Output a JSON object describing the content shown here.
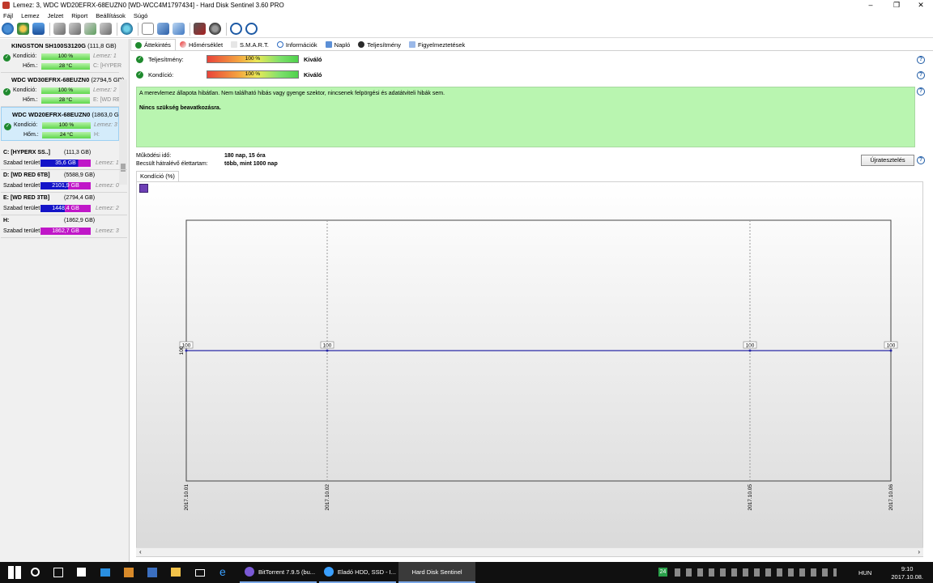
{
  "window": {
    "title": "Lemez: 3, WDC WD20EFRX-68EUZN0 [WD-WCC4M1797434]  -  Hard Disk Sentinel 3.60 PRO",
    "minimize": "–",
    "maximize": "❐",
    "close": "✕"
  },
  "menu": [
    "Fájl",
    "Lemez",
    "Jelzet",
    "Riport",
    "Beállítások",
    "Súgó"
  ],
  "disks": [
    {
      "name": "KINGSTON SH100S3120G",
      "size": "(111,8 GB)",
      "cond_label": "Kondíció:",
      "cond": "100 %",
      "temp_label": "Hőm.:",
      "temp": "28 °C",
      "disk_ref": "Lemez: 1",
      "drive_ref": "C: [HYPER"
    },
    {
      "name": "WDC WD30EFRX-68EUZN0",
      "size": "(2794,5 GB)",
      "cond_label": "Kondíció:",
      "cond": "100 %",
      "temp_label": "Hőm.:",
      "temp": "28 °C",
      "disk_ref": "Lemez: 2",
      "drive_ref": "E: [WD RE"
    },
    {
      "name": "WDC WD20EFRX-68EUZN0",
      "size": "(1863,0 GB)",
      "cond_label": "Kondíció:",
      "cond": "100 %",
      "temp_label": "Hőm.:",
      "temp": "24 °C",
      "disk_ref": "Lemez: 3",
      "drive_ref": "H:"
    }
  ],
  "volumes": [
    {
      "name": "C: [HYPERX SS..]",
      "size": "(111,3 GB)",
      "free_label": "Szabad terület",
      "free": "35,6 GB",
      "disk_ref": "Lemez: 1",
      "color": "#1414c8"
    },
    {
      "name": "D: [WD RED 6TB]",
      "size": "(5588,9 GB)",
      "free_label": "Szabad terület",
      "free": "2101,9 GB",
      "disk_ref": "Lemez: 0",
      "color": "#3a10c2"
    },
    {
      "name": "E: [WD RED 3TB]",
      "size": "(2794,4 GB)",
      "free_label": "Szabad terület",
      "free": "1448,4 GB",
      "disk_ref": "Lemez: 2",
      "color": "#3a10c2"
    },
    {
      "name": "H:",
      "size": "(1862,9 GB)",
      "free_label": "Szabad terület",
      "free": "1862,7 GB",
      "disk_ref": "Lemez: 3",
      "color": "#c017c8"
    }
  ],
  "tabs": [
    "Áttekintés",
    "Hőmérséklet",
    "S.M.A.R.T.",
    "Információk",
    "Napló",
    "Teljesítmény",
    "Figyelmeztetések"
  ],
  "overview": {
    "perf_label": "Teljesítmény:",
    "perf_value": "100 %",
    "perf_rating": "Kiváló",
    "cond_label": "Kondíció:",
    "cond_value": "100 %",
    "cond_rating": "Kiváló",
    "message": "A merevlemez állapota hibátlan. Nem található hibás vagy gyenge szektor, nincsenek felpörgési és adatátviteli hibák sem.",
    "advice": "Nincs szükség beavatkozásra.",
    "uptime_label": "Működési idő:",
    "uptime": "180 nap, 15 óra",
    "life_label": "Becsült hátralévő élettartam:",
    "life": "több, mint 1000 nap",
    "retest": "Újratesztelés",
    "chart_tab": "Kondíció  (%)"
  },
  "chart_data": {
    "type": "line",
    "x": [
      "2017.10.01",
      "2017.10.02",
      "2017.10.05",
      "2017.10.06"
    ],
    "y": [
      100,
      100,
      100,
      100
    ],
    "point_labels": [
      "100",
      "100",
      "100",
      "100"
    ],
    "ytick": "100",
    "line_color": "#2a2aa6",
    "grid": true
  },
  "taskbar": {
    "apps": [
      "BitTorrent 7.9.5  (bu...",
      "Eladó HDD, SSD - I...",
      "Hard Disk Sentinel"
    ],
    "tray_badge": "24",
    "lang": "HUN",
    "time": "9:10",
    "date": "2017.10.08."
  }
}
